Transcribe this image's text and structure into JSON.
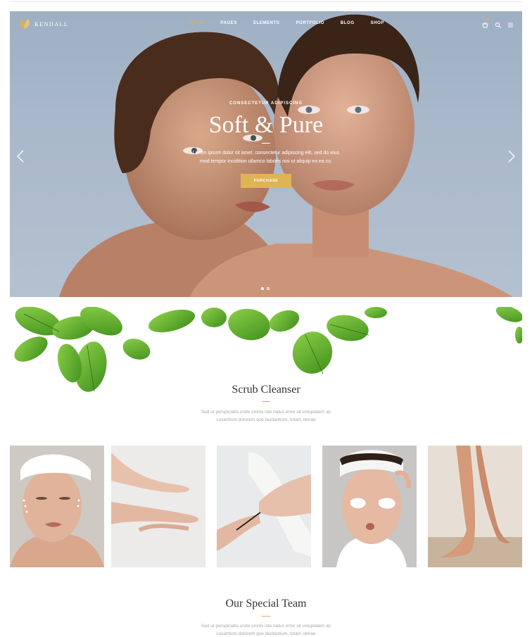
{
  "brand": {
    "name": "KENDALL",
    "accent": "#d8b25a"
  },
  "nav": {
    "items": [
      {
        "label": "HOME",
        "active": true
      },
      {
        "label": "PAGES",
        "active": false
      },
      {
        "label": "ELEMENTS",
        "active": false
      },
      {
        "label": "PORTFOLIO",
        "active": false
      },
      {
        "label": "BLOG",
        "active": false
      },
      {
        "label": "SHOP",
        "active": false
      }
    ],
    "icons": [
      "cart-icon",
      "search-icon",
      "menu-icon"
    ]
  },
  "hero": {
    "subtitle": "CONSECTETUR ADIPISCING",
    "title": "Soft & Pure",
    "text_line1": "Lorem ipsum dolor sit amet, consectetur adipiscing elit, sed do eius",
    "text_line2": "mod tempor incidition ullamco laboris nisi ut aliquip ex ea co.",
    "button": "PURCHASE",
    "slides": 2,
    "active_slide": 1
  },
  "scrub": {
    "title": "Scrub Cleanser",
    "text_line1": "Sed ut perspiciatis unde omnis iste natus error sit voluptatem ac",
    "text_line2": "cusantium dolorem que laudantium, totam remae"
  },
  "gallery": {
    "items": [
      "face-cream-photo",
      "hands-photo",
      "manicure-photo",
      "eye-patches-photo",
      "feet-photo"
    ]
  },
  "team": {
    "title": "Our Special Team",
    "text_line1": "Sed ut perspiciatis unde omnis iste natus error sit voluptatem ac",
    "text_line2": "cusantium dolorem que laudantium, totam remae"
  }
}
